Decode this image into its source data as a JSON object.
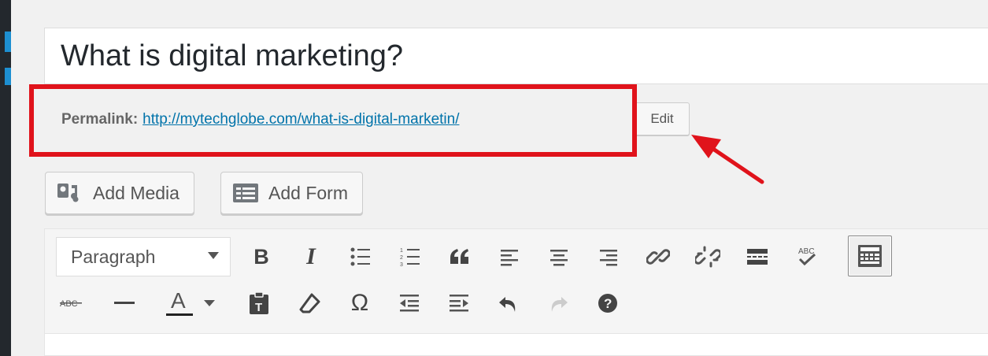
{
  "post": {
    "title": "What is digital marketing?"
  },
  "permalink": {
    "label": "Permalink:",
    "url_base": "http://mytechglobe.com/",
    "url_slug": "what-is-digital-marketin/",
    "edit_label": "Edit"
  },
  "media_buttons": {
    "add_media": "Add Media",
    "add_form": "Add Form"
  },
  "editor": {
    "format_select": "Paragraph",
    "toolbar_row1": [
      "bold-icon",
      "italic-icon",
      "bulleted-list-icon",
      "numbered-list-icon",
      "blockquote-icon",
      "align-left-icon",
      "align-center-icon",
      "align-right-icon",
      "insert-link-icon",
      "remove-link-icon",
      "read-more-icon",
      "spellcheck-icon",
      "toolbar-toggle-icon"
    ],
    "toolbar_row2": [
      "strikethrough-icon",
      "horizontal-line-icon",
      "text-color-icon",
      "paste-as-text-icon",
      "clear-formatting-icon",
      "special-character-icon",
      "outdent-icon",
      "indent-icon",
      "undo-icon",
      "redo-icon",
      "help-icon"
    ],
    "glyphs": {
      "bold": "B",
      "italic": "I",
      "omega": "Ω",
      "abc": "ABC",
      "text_color": "A"
    }
  },
  "colors": {
    "annotation_red": "#e0131b",
    "link_blue": "#0073aa",
    "sidebar": "#23282d"
  }
}
